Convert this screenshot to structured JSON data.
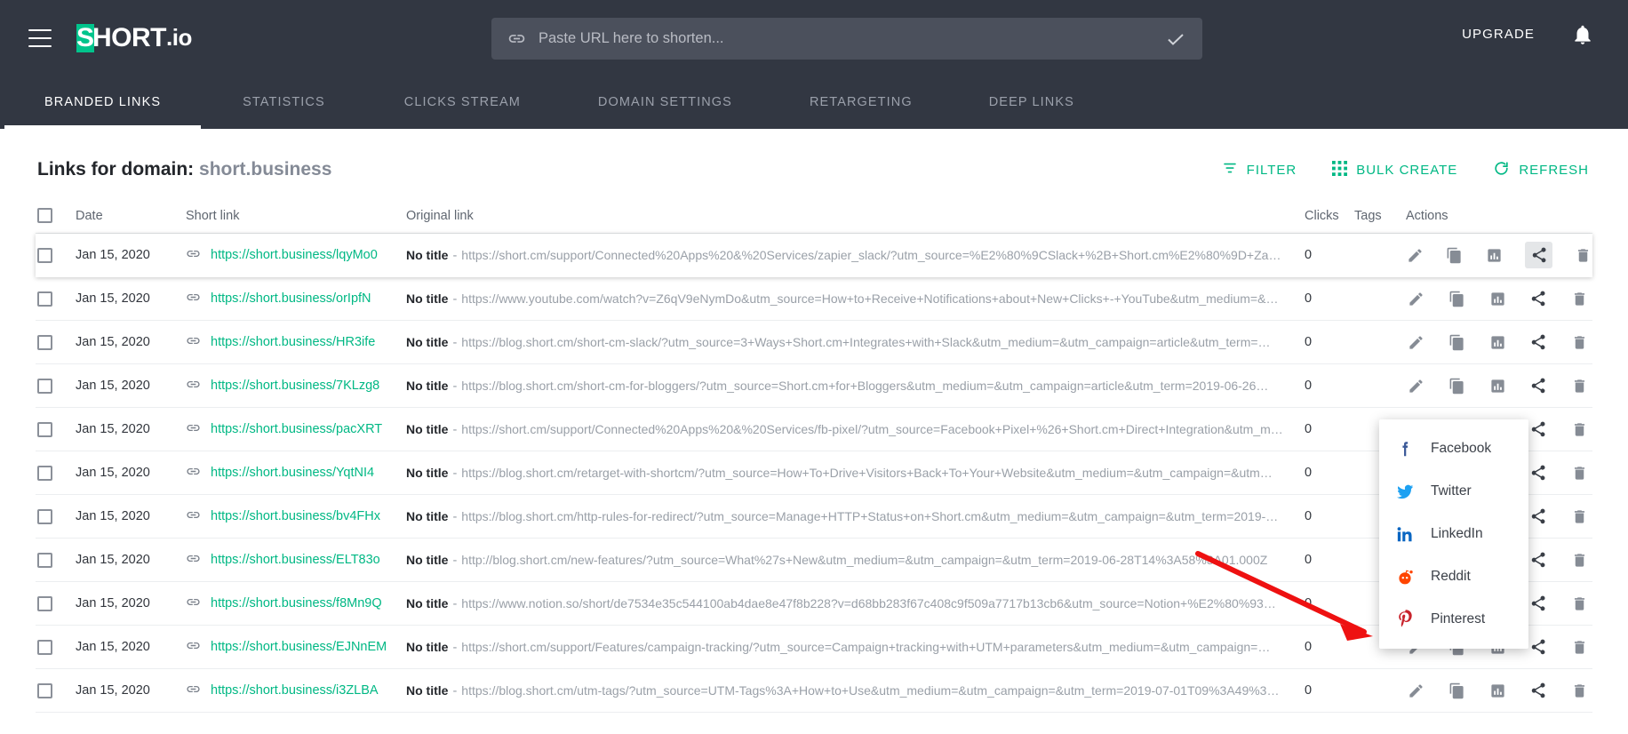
{
  "header": {
    "menu_icon": "hamburger-menu-icon",
    "logo_mark": "S",
    "logo_text": "HORT",
    "logo_suffix": ".io",
    "url_input_placeholder": "Paste URL here to shorten...",
    "url_input_value": "",
    "link_icon": "link-icon",
    "check_icon": "check-icon",
    "upgrade_label": "UPGRADE",
    "bell_icon": "bell-icon"
  },
  "tabs": [
    {
      "label": "BRANDED LINKS",
      "active": true
    },
    {
      "label": "STATISTICS",
      "active": false
    },
    {
      "label": "CLICKS STREAM",
      "active": false
    },
    {
      "label": "DOMAIN SETTINGS",
      "active": false
    },
    {
      "label": "RETARGETING",
      "active": false
    },
    {
      "label": "DEEP LINKS",
      "active": false
    }
  ],
  "page": {
    "title_prefix": "Links for domain:",
    "domain": "short.business",
    "actions": [
      {
        "label": "FILTER",
        "icon": "filter-icon"
      },
      {
        "label": "BULK CREATE",
        "icon": "grid-icon"
      },
      {
        "label": "REFRESH",
        "icon": "refresh-icon"
      }
    ]
  },
  "table": {
    "columns": [
      "Date",
      "Short link",
      "Original link",
      "Clicks",
      "Tags",
      "Actions"
    ],
    "row_actions": [
      "edit-icon",
      "copy-icon",
      "statistics-icon",
      "share-icon",
      "delete-icon"
    ],
    "rows": [
      {
        "date": "Jan 15, 2020",
        "short_link": "https://short.business/lqyMo0",
        "title": "No title",
        "original_link": "https://short.cm/support/Connected%20Apps%20&%20Services/zapier_slack/?utm_source=%E2%80%9CSlack+%2B+Short.cm%E2%80%9D+Zap&…",
        "clicks": "0",
        "tags": ""
      },
      {
        "date": "Jan 15, 2020",
        "short_link": "https://short.business/orIpfN",
        "title": "No title",
        "original_link": "https://www.youtube.com/watch?v=Z6qV9eNymDo&utm_source=How+to+Receive+Notifications+about+New+Clicks+-+YouTube&utm_medium=&…",
        "clicks": "0",
        "tags": ""
      },
      {
        "date": "Jan 15, 2020",
        "short_link": "https://short.business/HR3ife",
        "title": "No title",
        "original_link": "https://blog.short.cm/short-cm-slack/?utm_source=3+Ways+Short.cm+Integrates+with+Slack&utm_medium=&utm_campaign=article&utm_term=…",
        "clicks": "0",
        "tags": ""
      },
      {
        "date": "Jan 15, 2020",
        "short_link": "https://short.business/7KLzg8",
        "title": "No title",
        "original_link": "https://blog.short.cm/short-cm-for-bloggers/?utm_source=Short.cm+for+Bloggers&utm_medium=&utm_campaign=article&utm_term=2019-06-26…",
        "clicks": "0",
        "tags": ""
      },
      {
        "date": "Jan 15, 2020",
        "short_link": "https://short.business/pacXRT",
        "title": "No title",
        "original_link": "https://short.cm/support/Connected%20Apps%20&%20Services/fb-pixel/?utm_source=Facebook+Pixel+%26+Short.cm+Direct+Integration&utm_m…",
        "clicks": "0",
        "tags": ""
      },
      {
        "date": "Jan 15, 2020",
        "short_link": "https://short.business/YqtNI4",
        "title": "No title",
        "original_link": "https://blog.short.cm/retarget-with-shortcm/?utm_source=How+To+Drive+Visitors+Back+To+Your+Website&utm_medium=&utm_campaign=&utm…",
        "clicks": "0",
        "tags": ""
      },
      {
        "date": "Jan 15, 2020",
        "short_link": "https://short.business/bv4FHx",
        "title": "No title",
        "original_link": "https://blog.short.cm/http-rules-for-redirect/?utm_source=Manage+HTTP+Status+on+Short.cm&utm_medium=&utm_campaign=&utm_term=2019-…",
        "clicks": "0",
        "tags": ""
      },
      {
        "date": "Jan 15, 2020",
        "short_link": "https://short.business/ELT83o",
        "title": "No title",
        "original_link": "http://blog.short.cm/new-features/?utm_source=What%27s+New&utm_medium=&utm_campaign=&utm_term=2019-06-28T14%3A58%3A01.000Z",
        "clicks": "0",
        "tags": ""
      },
      {
        "date": "Jan 15, 2020",
        "short_link": "https://short.business/f8Mn9Q",
        "title": "No title",
        "original_link": "https://www.notion.so/short/de7534e35c544100ab4dae8e47f8b228?v=d68bb283f67c408c9f509a7717b13cb6&utm_source=Notion+%E2%80%93…",
        "clicks": "0",
        "tags": ""
      },
      {
        "date": "Jan 15, 2020",
        "short_link": "https://short.business/EJNnEM",
        "title": "No title",
        "original_link": "https://short.cm/support/Features/campaign-tracking/?utm_source=Campaign+tracking+with+UTM+parameters&utm_medium=&utm_campaign=…",
        "clicks": "0",
        "tags": ""
      },
      {
        "date": "Jan 15, 2020",
        "short_link": "https://short.business/i3ZLBA",
        "title": "No title",
        "original_link": "https://blog.short.cm/utm-tags/?utm_source=UTM-Tags%3A+How+to+Use&utm_medium=&utm_campaign=&utm_term=2019-07-01T09%3A49%3A…",
        "clicks": "0",
        "tags": ""
      }
    ]
  },
  "share_menu": {
    "items": [
      {
        "label": "Facebook",
        "icon": "facebook-icon",
        "color": "#3b5998"
      },
      {
        "label": "Twitter",
        "icon": "twitter-icon",
        "color": "#1da1f2"
      },
      {
        "label": "LinkedIn",
        "icon": "linkedin-icon",
        "color": "#0a66c2"
      },
      {
        "label": "Reddit",
        "icon": "reddit-icon",
        "color": "#ff4500"
      },
      {
        "label": "Pinterest",
        "icon": "pinterest-icon",
        "color": "#c8232c"
      }
    ]
  },
  "annotation": {
    "arrow_color": "#ee1111"
  },
  "colors": {
    "brand_green": "#00b884",
    "header_bg": "#323742",
    "accent_text": "#ffffff"
  }
}
